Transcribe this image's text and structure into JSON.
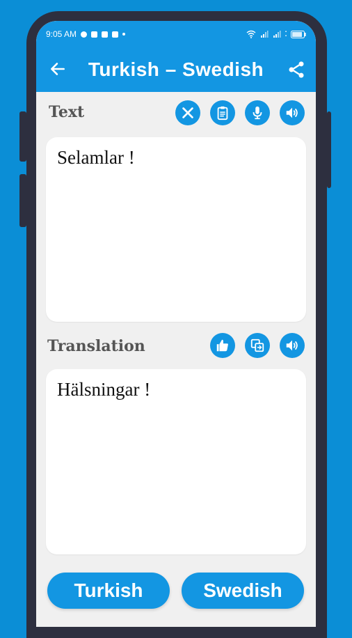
{
  "status": {
    "time": "9:05 AM",
    "battery_label": ""
  },
  "appbar": {
    "title": "Turkish – Swedish"
  },
  "source": {
    "label": "Text",
    "text": "Selamlar !"
  },
  "target": {
    "label": "Translation",
    "text": "Hälsningar !"
  },
  "buttons": {
    "source_lang": "Turkish",
    "target_lang": "Swedish"
  },
  "icons": {
    "back": "arrow-left-icon",
    "share": "share-icon",
    "clear": "close-icon",
    "paste": "clipboard-icon",
    "mic": "microphone-icon",
    "speak": "speaker-icon",
    "like": "thumbs-up-icon",
    "copy": "copy-icon"
  },
  "colors": {
    "primary": "#1396e2",
    "background": "#0b8ed6",
    "frame": "#2d2f3f"
  }
}
